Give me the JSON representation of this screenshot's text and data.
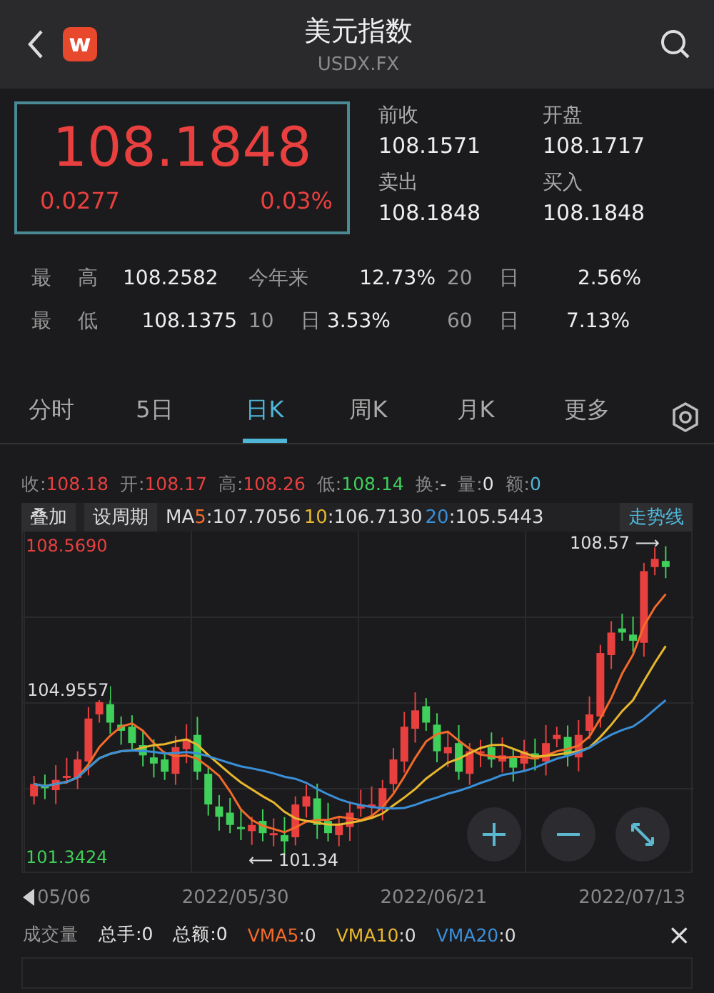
{
  "header": {
    "logo_text": "w",
    "title": "美元指数",
    "subtitle": "USDX.FX"
  },
  "quote": {
    "price": "108.1848",
    "change": "0.0277",
    "change_pct": "0.03%"
  },
  "fields": [
    {
      "label": "前收",
      "value": "108.1571"
    },
    {
      "label": "开盘",
      "value": "108.1717"
    },
    {
      "label": "卖出",
      "value": "108.1848"
    },
    {
      "label": "买入",
      "value": "108.1848"
    }
  ],
  "stats": [
    [
      {
        "label": "最 高",
        "value": "108.2582"
      },
      {
        "label": "今年来",
        "value": "12.73%"
      },
      {
        "label": "20 日",
        "value": "2.56%"
      }
    ],
    [
      {
        "label": "最 低",
        "value": "108.1375"
      },
      {
        "label": "10 日",
        "value": "3.53%"
      },
      {
        "label": "60 日",
        "value": "7.13%"
      }
    ]
  ],
  "tabs": [
    {
      "label": "分时",
      "selected": false
    },
    {
      "label": "5日",
      "selected": false
    },
    {
      "label": "日K",
      "selected": true
    },
    {
      "label": "周K",
      "selected": false
    },
    {
      "label": "月K",
      "selected": false
    },
    {
      "label": "更多",
      "selected": false
    }
  ],
  "ohlc": [
    {
      "label": "收:",
      "value": "108.18",
      "color": "#e8403f"
    },
    {
      "label": "开:",
      "value": "108.17",
      "color": "#e8403f"
    },
    {
      "label": "高:",
      "value": "108.26",
      "color": "#e8403f"
    },
    {
      "label": "低:",
      "value": "108.14",
      "color": "#3fcf5a"
    },
    {
      "label": "换:",
      "value": "-",
      "color": "#e6e6e6"
    },
    {
      "label": "量:",
      "value": "0",
      "color": "#e6e6e6"
    },
    {
      "label": "额:",
      "value": "0",
      "color": "#4fb6d8"
    }
  ],
  "toolbar": {
    "buttons": [
      "叠加",
      "设周期"
    ],
    "ma_prefix": "MA",
    "ma": [
      {
        "period": "5",
        "value": ":107.7056",
        "color": "#f36a2a"
      },
      {
        "period": "10",
        "value": ":106.7130",
        "color": "#e9b72d"
      },
      {
        "period": "20",
        "value": ":105.5443",
        "color": "#3a8fd9"
      }
    ],
    "trend_button": "走势线"
  },
  "chart": {
    "top_label": "108.5690",
    "mid_label": "104.9557",
    "bottom_label": "101.3424",
    "high_marker": "108.57 ⟶",
    "low_marker": "⟵ 101.34",
    "dates": [
      "05/06",
      "2022/05/30",
      "2022/06/21",
      "2022/07/13"
    ]
  },
  "volume": {
    "title": "成交量",
    "items": [
      {
        "text": "总手:0",
        "color": "#e6e6e6"
      },
      {
        "text": "总额:0",
        "color": "#e6e6e6"
      },
      {
        "label": "VMA5",
        "text": ":0",
        "color": "#f36a2a"
      },
      {
        "label": "VMA10",
        "text": ":0",
        "color": "#e9b72d"
      },
      {
        "label": "VMA20",
        "text": ":0",
        "color": "#3a8fd9"
      }
    ],
    "close": "×"
  }
}
